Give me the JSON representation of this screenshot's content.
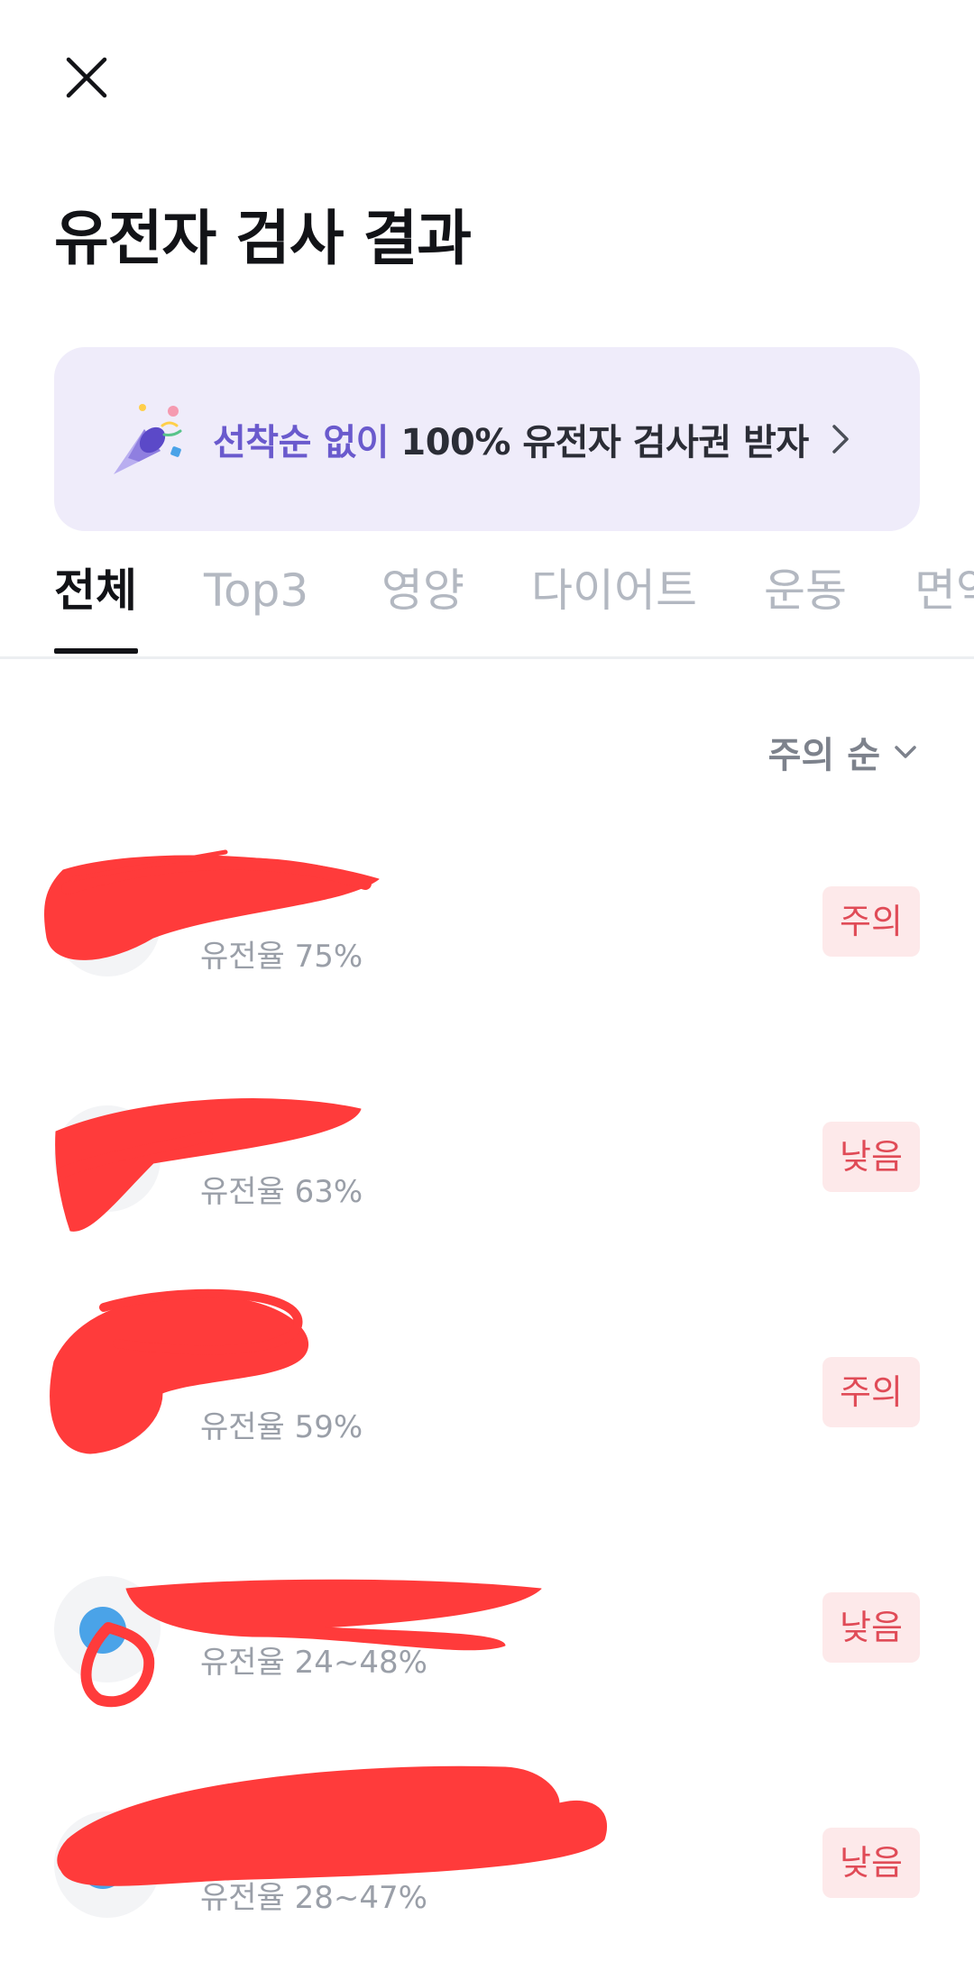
{
  "header": {
    "close_icon": "close-icon",
    "title": "유전자 검사 결과"
  },
  "promo": {
    "icon": "party-popper-icon",
    "accent_text": "선착순 없이",
    "main_text": "100% 유전자 검사권 받자",
    "chevron_icon": "chevron-right-icon",
    "accent_color": "#6a5acd",
    "background_color": "#efecfa"
  },
  "tabs": [
    {
      "label": "전체",
      "active": true
    },
    {
      "label": "Top3",
      "active": false
    },
    {
      "label": "영양",
      "active": false
    },
    {
      "label": "다이어트",
      "active": false
    },
    {
      "label": "운동",
      "active": false
    },
    {
      "label": "면역",
      "active": false
    }
  ],
  "sort": {
    "label": "주의 순",
    "icon": "chevron-down-icon"
  },
  "results": [
    {
      "name": "",
      "rate": "유전율 75%",
      "badge": "주의"
    },
    {
      "name": "",
      "rate": "유전율 63%",
      "badge": "낮음"
    },
    {
      "name": "",
      "rate": "유전율 59%",
      "badge": "주의"
    },
    {
      "name": "",
      "rate": "유전율 24~48%",
      "badge": "낮음"
    },
    {
      "name": "",
      "rate": "유전율 28~47%",
      "badge": "낮음"
    }
  ],
  "colors": {
    "badge_background": "#fde9ea",
    "badge_text": "#e04b57",
    "redaction": "#ff3b3b"
  }
}
